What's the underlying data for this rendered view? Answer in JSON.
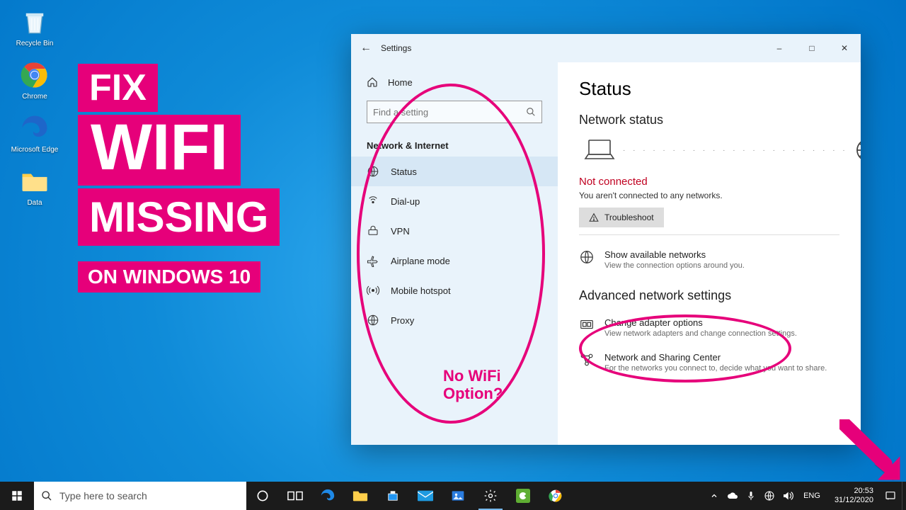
{
  "desktop_icons": [
    {
      "name": "recycle-bin",
      "label": "Recycle Bin"
    },
    {
      "name": "chrome",
      "label": "Chrome"
    },
    {
      "name": "edge",
      "label": "Microsoft Edge"
    },
    {
      "name": "data-folder",
      "label": "Data"
    }
  ],
  "promo": {
    "line1": "FIX",
    "line2": "WIFI",
    "line3": "MISSING",
    "line4": "ON WINDOWS 10"
  },
  "window": {
    "title": "Settings",
    "sidebar": {
      "home": "Home",
      "search_placeholder": "Find a setting",
      "section": "Network & Internet",
      "items": [
        {
          "icon": "globe-icon",
          "label": "Status",
          "active": true
        },
        {
          "icon": "dialup-icon",
          "label": "Dial-up"
        },
        {
          "icon": "vpn-icon",
          "label": "VPN"
        },
        {
          "icon": "airplane-icon",
          "label": "Airplane mode"
        },
        {
          "icon": "hotspot-icon",
          "label": "Mobile hotspot"
        },
        {
          "icon": "proxy-icon",
          "label": "Proxy"
        }
      ]
    },
    "content": {
      "title": "Status",
      "subtitle": "Network status",
      "not_connected_title": "Not connected",
      "not_connected_sub": "You aren't connected to any networks.",
      "troubleshoot": "Troubleshoot",
      "show_networks_title": "Show available networks",
      "show_networks_sub": "View the connection options around you.",
      "advanced_heading": "Advanced network settings",
      "adapter_title": "Change adapter options",
      "adapter_sub": "View network adapters and change connection settings.",
      "sharing_title": "Network and Sharing Center",
      "sharing_sub": "For the networks you connect to, decide what you want to share."
    }
  },
  "annotation": {
    "no_wifi": "No WiFi\nOption?"
  },
  "taskbar": {
    "search_placeholder": "Type here to search",
    "lang": "ENG",
    "time": "20:53",
    "date": "31/12/2020"
  }
}
